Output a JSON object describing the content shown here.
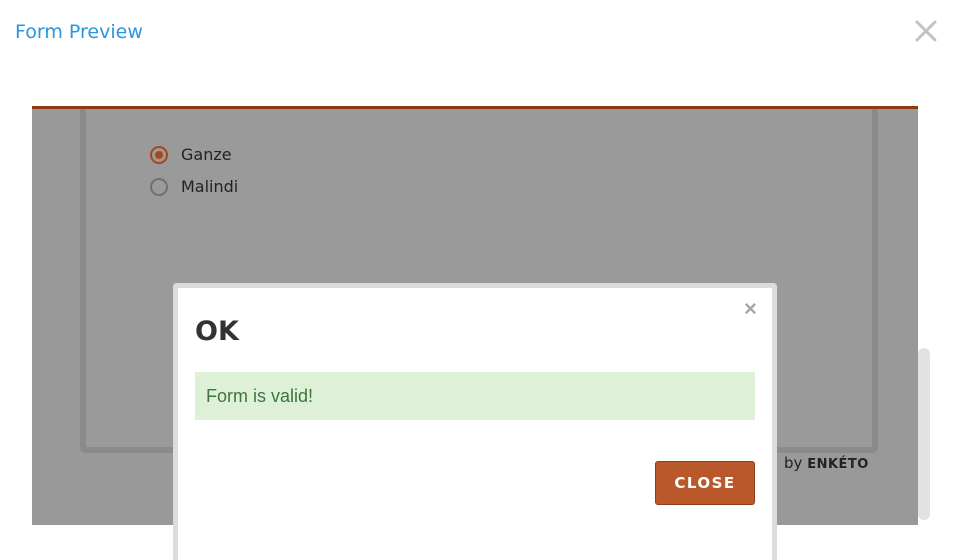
{
  "header": {
    "title": "Form Preview",
    "close_icon": "close-x-icon"
  },
  "form": {
    "options": [
      {
        "label": "Ganze",
        "checked": true
      },
      {
        "label": "Malindi",
        "checked": false
      }
    ],
    "powered_by_prefix": "by",
    "powered_by_brand": "ENKÉTO"
  },
  "modal": {
    "title": "OK",
    "close_icon": "times-icon",
    "close_glyph": "×",
    "message": "Form is valid!",
    "button_label": "CLOSE"
  },
  "colors": {
    "link_blue": "#2a95e0",
    "accent": "#a8471a",
    "button": "#b9582a",
    "success_bg": "#dff0d8",
    "success_text": "#3c763d"
  }
}
